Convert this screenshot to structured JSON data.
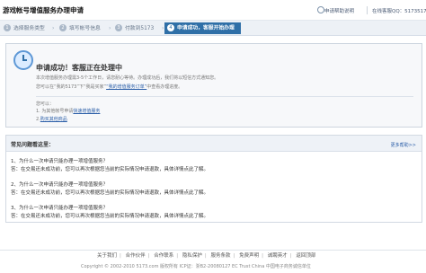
{
  "header": {
    "title": "游戏帐号增值服务办理申请",
    "help_link": "申请帮助说明",
    "online_support": "在线客服QQ：5173517□"
  },
  "steps": [
    {
      "num": "1",
      "label": "选择服务类型"
    },
    {
      "num": "2",
      "label": "填写帐号信息"
    },
    {
      "num": "3",
      "label": "付款到5173"
    },
    {
      "num": "4",
      "label": "申请成功，客服开始办理"
    }
  ],
  "status": {
    "title": "申请成功！客服正在处理中",
    "line1": "本次增值服务办理需3-5个工作日，请您耐心等待。办理成功后，我们将以短信方式通知您。",
    "line2_prefix": "您可以在“我的5173”下“我是买家”",
    "line2_link": "“我的增值服务订单”",
    "line2_suffix": "中查看办理进度。",
    "options_label": "您可以：",
    "option1_prefix": "1. 为其他帐号申请",
    "option1_link": "快速增值服务",
    "option2_prefix": "2.",
    "option2_link": "购买其他商品"
  },
  "faq": {
    "title": "常见问题看这里：",
    "more": "更多帮助>>",
    "items": [
      {
        "q": "1、为什么一次申请只能办理一项增值服务？",
        "a": "答：在交易还未成功前，您可以再次根据您当前的实际情况申请退款，具体详情点此了解。"
      },
      {
        "q": "2、为什么一次申请只能办理一项增值服务？",
        "a": "答：在交易还未成功前，您可以再次根据您当前的实际情况申请退款，具体详情点此了解。"
      },
      {
        "q": "3、为什么一次申请只能办理一项增值服务？",
        "a": "答：在交易还未成功前，您可以再次根据您当前的实际情况申请退款，具体详情点此了解。"
      }
    ]
  },
  "footer": {
    "links": [
      "关于我们",
      "合作伙伴",
      "合作联系",
      "隐私保护",
      "服务条款",
      "免费声明",
      "诚聘英才",
      "返回顶部"
    ],
    "copyright": "Copyright © 2002-2010 5173.com 版权所有   ICP证：浙B2-20080127   EC Trust China 中国电子商务诚信单位"
  }
}
